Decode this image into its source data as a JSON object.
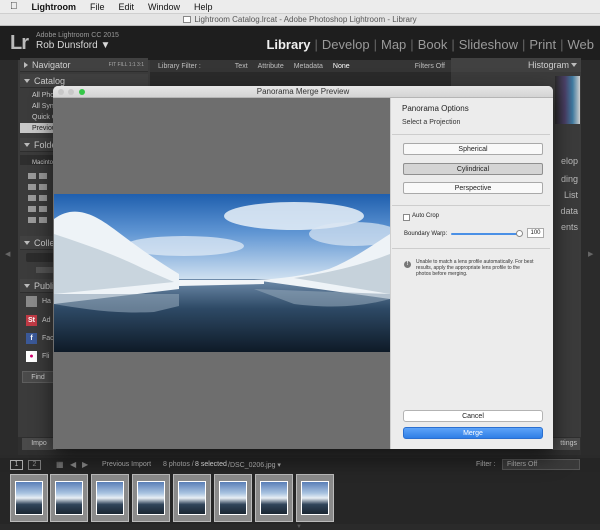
{
  "menubar": {
    "apple": "",
    "app": "Lightroom",
    "items": [
      "File",
      "Edit",
      "Window",
      "Help"
    ]
  },
  "window_title": "Lightroom Catalog.lrcat - Adobe Photoshop Lightroom - Library",
  "identity": {
    "logo": "Lr",
    "version": "Adobe Lightroom CC 2015",
    "user": "Rob Dunsford ▼"
  },
  "modules": [
    "Library",
    "Develop",
    "Map",
    "Book",
    "Slideshow",
    "Print",
    "Web"
  ],
  "left_panel": {
    "navigator": "Navigator",
    "navigator_zoom": [
      "FIT",
      "FILL",
      "1:1",
      "3:1"
    ],
    "catalog": "Catalog",
    "catalog_items": [
      "All Pho",
      "All Syn",
      "Quick C",
      "Previous"
    ],
    "folders": "Folders",
    "macintosh": "Macinto",
    "collections": "Collect",
    "publish": "Publis",
    "publish_items": [
      "Ha",
      "Ad",
      "Fac",
      "Fli"
    ],
    "find": "Find",
    "import": "Impo"
  },
  "filter_bar": {
    "label": "Library Filter :",
    "options": [
      "Text",
      "Attribute",
      "Metadata",
      "None"
    ],
    "filters_off": "Filters Off"
  },
  "right_panel": {
    "histogram": "Histogram",
    "items": [
      "elop",
      "ding",
      "List",
      "data",
      "ents"
    ],
    "settings": "ttings"
  },
  "dialog": {
    "title": "Panorama Merge Preview",
    "options_title": "Panorama Options",
    "select_projection": "Select a Projection",
    "projections": [
      "Spherical",
      "Cylindrical",
      "Perspective"
    ],
    "selected_projection": "Cylindrical",
    "auto_crop_label": "Auto Crop",
    "auto_crop_checked": false,
    "boundary_warp_label": "Boundary Warp:",
    "boundary_warp_value": "100",
    "warning": "Unable to match a lens profile automatically. For best results, apply the appropriate lens profile to the photos before merging.",
    "cancel": "Cancel",
    "merge": "Merge"
  },
  "filmbar": {
    "view1": "1",
    "view2": "2",
    "source": "Previous Import",
    "count": "8 photos /",
    "selected": "8 selected",
    "filename": "/DSC_0206.jpg ▾",
    "filter_label": "Filter :",
    "filter_value": "Filters Off"
  },
  "filmstrip": {
    "thumbnail_count": 8
  },
  "colors": {
    "accent": "#2f7ee6",
    "panel": "#3b3b3b",
    "dialog": "#ececec"
  }
}
